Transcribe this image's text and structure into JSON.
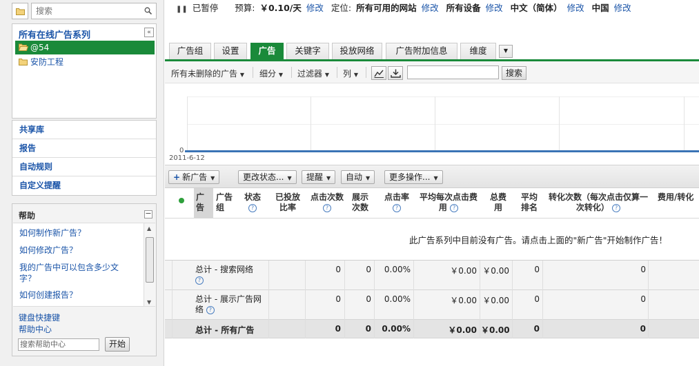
{
  "sidebar": {
    "search_placeholder": "搜索",
    "campaigns_title": "所有在线广告系列",
    "collapse_icon": "«",
    "campaigns": [
      {
        "label": "@54",
        "selected": true
      },
      {
        "label": "安防工程",
        "selected": false
      }
    ],
    "nav": [
      "共享库",
      "报告",
      "自动规则",
      "自定义提醒"
    ],
    "help": {
      "title": "帮助",
      "minimize": "−",
      "questions": [
        "如何制作新广告？",
        "如何修改广告？",
        "我的广告中可以包含多少文字？",
        "如何创建报告？"
      ],
      "links": [
        "键盘快捷键",
        "帮助中心"
      ],
      "search_placeholder": "搜索帮助中心",
      "start_button": "开始"
    }
  },
  "status": {
    "paused_label": "已暂停",
    "budget_label": "预算:",
    "budget_value": "￥0.10/天",
    "edit": "修改",
    "targeting_label": "定位:",
    "network_value": "所有可用的网站",
    "device_value": "所有设备",
    "language_value": "中文（简体）",
    "country_value": "中国"
  },
  "tabs": [
    "广告组",
    "设置",
    "广告",
    "关键字",
    "投放网络",
    "广告附加信息",
    "维度"
  ],
  "active_tab": "广告",
  "toolbar": {
    "filter_all": "所有未删除的广告",
    "segment": "细分",
    "filter": "过滤器",
    "columns": "列",
    "search_button": "搜索"
  },
  "chart": {
    "y_tick": "0",
    "x_tick": "2011-6-12"
  },
  "chart_data": {
    "type": "line",
    "x": [
      "2011-6-12"
    ],
    "series": [
      {
        "values": [
          0
        ]
      }
    ],
    "xlabel": "",
    "ylabel": "",
    "grid": true
  },
  "actions": {
    "new_ad": "新广告",
    "change_status": "更改状态...",
    "alerts": "提醒",
    "automate": "自动",
    "more": "更多操作..."
  },
  "table": {
    "headers": {
      "ad": "广告",
      "adgroup": "广告组",
      "status": "状态",
      "served": "已投放比率",
      "clicks": "点击次数",
      "impr": "展示次数",
      "ctr": "点击率",
      "avg_cpc": "平均每次点击费用",
      "cost": "总费用",
      "avg_pos": "平均排名",
      "conv": "转化次数（每次点击仅算一次转化）",
      "cost_conv": "费用/转化"
    },
    "empty_message": "此广告系列中目前没有广告。请点击上面的\"新广告\"开始制作广告！",
    "rows": [
      {
        "label": "总计 - 搜索网络",
        "clicks": "0",
        "impr": "0",
        "ctr": "0.00%",
        "avg_cpc": "￥0.00",
        "cost": "￥0.00",
        "avg_pos": "0",
        "conv": "0"
      },
      {
        "label": "总计 - 展示广告网络",
        "clicks": "0",
        "impr": "0",
        "ctr": "0.00%",
        "avg_cpc": "￥0.00",
        "cost": "￥0.00",
        "avg_pos": "0",
        "conv": "0"
      },
      {
        "label": "总计 - 所有广告",
        "clicks": "0",
        "impr": "0",
        "ctr": "0.00%",
        "avg_cpc": "￥0.00",
        "cost": "￥0.00",
        "avg_pos": "0",
        "conv": "0"
      }
    ]
  },
  "colors": {
    "accent_green": "#1a8a3a",
    "link_blue": "#1a54a8",
    "chart_line": "#3a73b5"
  }
}
